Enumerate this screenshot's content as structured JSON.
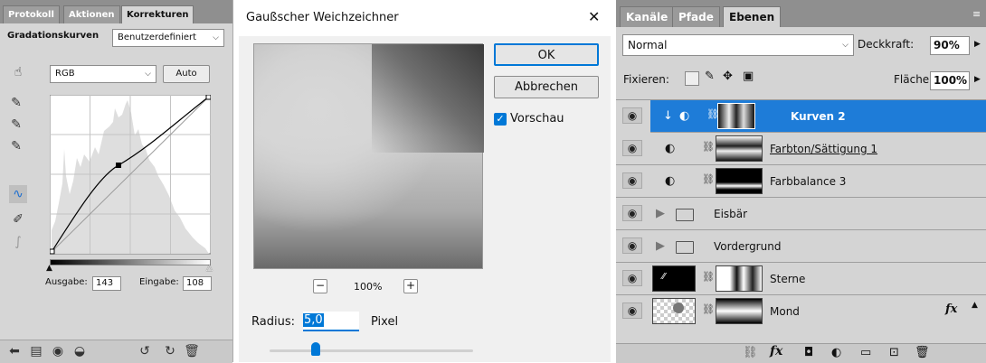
{
  "left": {
    "tabs": [
      "Protokoll",
      "Aktionen",
      "Korrekturen"
    ],
    "title": "Gradationskurven",
    "preset": "Benutzerdefiniert",
    "channel": "RGB",
    "auto_label": "Auto",
    "output_label": "Ausgabe:",
    "output_value": "143",
    "input_label": "Eingabe:",
    "input_value": "108"
  },
  "dialog": {
    "title": "Gaußscher Weichzeichner",
    "ok_label": "OK",
    "cancel_label": "Abbrechen",
    "preview_label": "Vorschau",
    "zoom": "100%",
    "zoom_minus": "−",
    "zoom_plus": "+",
    "radius_label": "Radius:",
    "radius_value": "5,0",
    "radius_unit": "Pixel",
    "close_glyph": "✕"
  },
  "right": {
    "tabs": [
      "Kanäle",
      "Pfade",
      "Ebenen"
    ],
    "blend_mode": "Normal",
    "opacity_label": "Deckkraft:",
    "opacity_value": "90%",
    "lock_label": "Fixieren:",
    "fill_label": "Fläche:",
    "fill_value": "100%",
    "layers": [
      {
        "name": "Kurven 2",
        "selected": true
      },
      {
        "name": "Farbton/Sättigung 1",
        "selected": false
      },
      {
        "name": "Farbbalance 3",
        "selected": false
      },
      {
        "name": "Eisbär",
        "selected": false
      },
      {
        "name": "Vordergrund",
        "selected": false
      },
      {
        "name": "Sterne",
        "selected": false
      },
      {
        "name": "Mond",
        "selected": false
      }
    ],
    "fx_label": "fx"
  }
}
